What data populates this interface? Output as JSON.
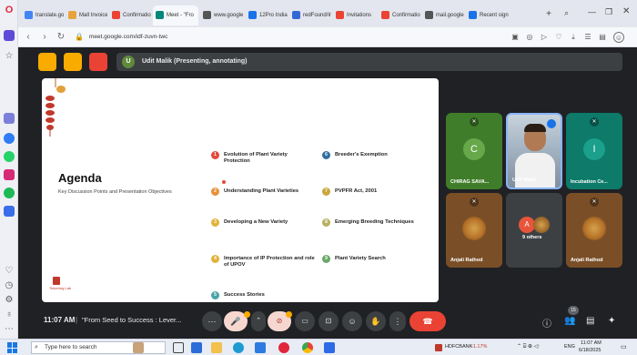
{
  "browser": {
    "tabs": [
      {
        "label": "translate.go",
        "color": "#4285f4"
      },
      {
        "label": "Mall Invoice",
        "color": "#e8a33b"
      },
      {
        "label": "Confirmatio",
        "color": "#ea4335"
      },
      {
        "label": "Meet - \"Fro",
        "color": "#00897b"
      },
      {
        "label": "www.google",
        "color": "#555555"
      },
      {
        "label": "12Pro India",
        "color": "#1a73e8"
      },
      {
        "label": "redFound/In",
        "color": "#3367d6"
      },
      {
        "label": "Invitations",
        "color": "#ea4335"
      },
      {
        "label": "Confirmatio",
        "color": "#ea4335"
      },
      {
        "label": "mail.google",
        "color": "#555555"
      },
      {
        "label": "Recent sign",
        "color": "#1a73e8"
      }
    ],
    "new_tab": "+",
    "url": "meet.google.com/idf-zuvn-twc"
  },
  "meet": {
    "presenter_label": "Udit Malik (Presenting, annotating)",
    "presenter_initial": "U",
    "slide": {
      "title": "Agenda",
      "subtitle": "Key Discussion Points and Presentation Objectives",
      "logo_text": "Tinkering Lab",
      "items": [
        {
          "num": "1",
          "text": "Evolution of Plant Variety Protection",
          "color": "#e24a3b"
        },
        {
          "num": "2",
          "text": "Understanding Plant Varieties",
          "color": "#e8913a"
        },
        {
          "num": "3",
          "text": "Developing a New Variety",
          "color": "#e0b33a"
        },
        {
          "num": "4",
          "text": "Importance of IP Protection and role of UPOV",
          "color": "#e0b33a"
        },
        {
          "num": "5",
          "text": "Success Stories",
          "color": "#4aa3a8"
        },
        {
          "num": "6",
          "text": "Breeder's Exemption",
          "color": "#2f6f9f"
        },
        {
          "num": "7",
          "text": "PVPFR Act, 2001",
          "color": "#c9a83a"
        },
        {
          "num": "8",
          "text": "Emerging Breeding Techniques",
          "color": "#b8b060"
        },
        {
          "num": "9",
          "text": "Plant Variety Search",
          "color": "#6aa86a"
        }
      ]
    },
    "tiles": [
      {
        "name": "CHIRAG SAVA...",
        "initial": "C",
        "bg": "#3f7d2a",
        "avatar_bg": "#66a84a"
      },
      {
        "name": "Udit Malik",
        "bg": "#9fb2c5"
      },
      {
        "name": "Incubation Ce...",
        "initial": "I",
        "bg": "#0d7a6a",
        "avatar_bg": "#1aa08b"
      },
      {
        "name": "Anjali Rathod",
        "bg": "#7a4f28"
      },
      {
        "name": "9 others",
        "initial": "A",
        "bg": "#3c4043"
      },
      {
        "name": "Anjali Rathod",
        "bg": "#7a4f28"
      }
    ],
    "bottom": {
      "time": "11:07 AM",
      "separator": "|",
      "title": "\"From Seed to Success : Lever...",
      "participants_badge": "15"
    }
  },
  "taskbar": {
    "search_placeholder": "Type here to search",
    "stock_name": "HDFCBANK",
    "stock_change": "-1.17%",
    "lang": "ENG",
    "time": "11:07 AM",
    "date": "6/18/2025"
  },
  "colors": {
    "end_call": "#ea4335",
    "meet_bg": "#202124",
    "control_bg": "#3c4043"
  }
}
